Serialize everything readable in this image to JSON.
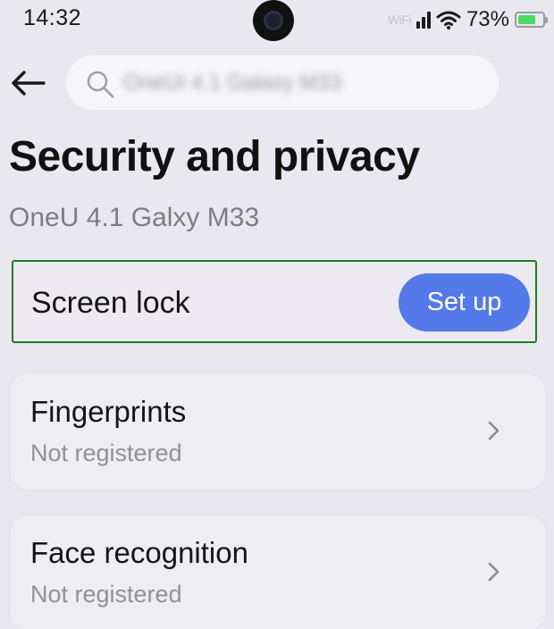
{
  "status_bar": {
    "time": "14:32",
    "vowifi_label": "WiFi",
    "battery_percent": "73%",
    "battery_level": 0.73,
    "battery_color": "#4cd964"
  },
  "header": {
    "back_icon": "arrow-left-icon",
    "search": {
      "icon": "search-icon",
      "value": "OneUI 4.1 Galaxy M33"
    }
  },
  "page": {
    "title": "Security and privacy",
    "subtitle": "OneU 4.1 Galxy M33"
  },
  "screen_lock": {
    "label": "Screen lock",
    "button_label": "Set up",
    "button_color": "#5479e8",
    "highlight_color": "#1f7a1f"
  },
  "items": [
    {
      "title": "Fingerprints",
      "status": "Not registered",
      "icon": "chevron-right-icon"
    },
    {
      "title": "Face recognition",
      "status": "Not registered",
      "icon": "chevron-right-icon"
    }
  ]
}
